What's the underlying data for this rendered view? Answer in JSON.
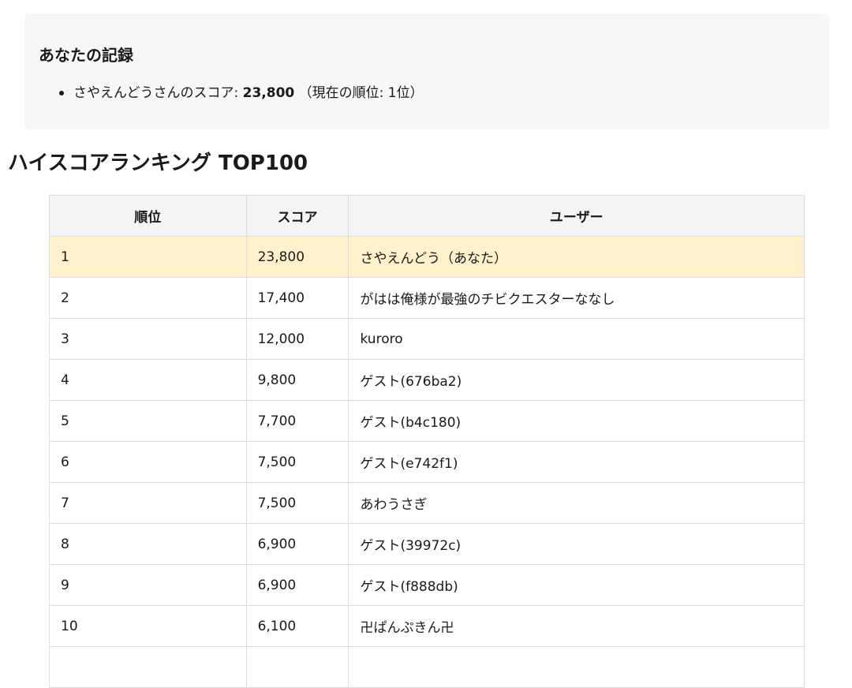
{
  "record": {
    "title": "あなたの記録",
    "score_prefix": "さやえんどうさんのスコア: ",
    "score_value": "23,800",
    "rank_text": " （現在の順位: 1位）"
  },
  "ranking": {
    "title": "ハイスコアランキング TOP100",
    "headers": {
      "rank": "順位",
      "score": "スコア",
      "user": "ユーザー"
    },
    "highlight_color": "#fff1cc",
    "rows": [
      {
        "rank": "1",
        "score": "23,800",
        "user": "さやえんどう（あなた）"
      },
      {
        "rank": "2",
        "score": "17,400",
        "user": "がはは俺様が最強のチビクエスターななし"
      },
      {
        "rank": "3",
        "score": "12,000",
        "user": "kuroro"
      },
      {
        "rank": "4",
        "score": "9,800",
        "user": "ゲスト(676ba2)"
      },
      {
        "rank": "5",
        "score": "7,700",
        "user": "ゲスト(b4c180)"
      },
      {
        "rank": "6",
        "score": "7,500",
        "user": "ゲスト(e742f1)"
      },
      {
        "rank": "7",
        "score": "7,500",
        "user": "あわうさぎ"
      },
      {
        "rank": "8",
        "score": "6,900",
        "user": "ゲスト(39972c)"
      },
      {
        "rank": "9",
        "score": "6,900",
        "user": "ゲスト(f888db)"
      },
      {
        "rank": "10",
        "score": "6,100",
        "user": "卍ぱんぷきん卍"
      },
      {
        "rank": "",
        "score": "",
        "user": ""
      }
    ]
  }
}
